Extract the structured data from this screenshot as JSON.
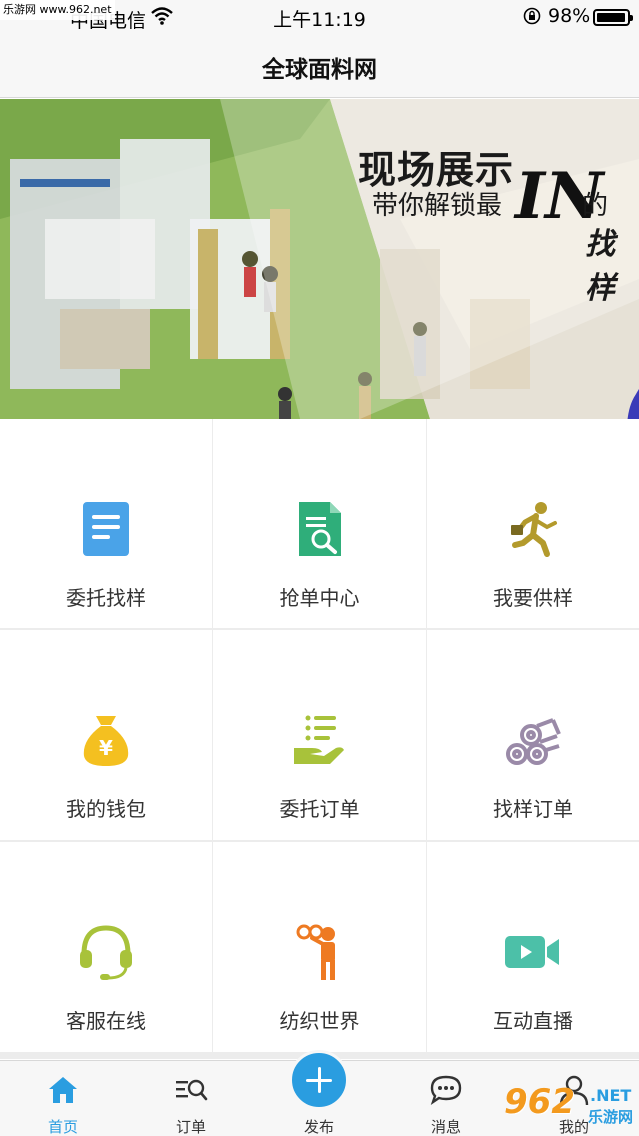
{
  "status_bar": {
    "watermark": "乐游网 www.962.net",
    "carrier": "中国电信",
    "time": "上午11:19",
    "battery": "98%"
  },
  "nav": {
    "title": "全球面料网"
  },
  "banner": {
    "headline": "现场展示",
    "subline": "带你解锁最",
    "big_text": "IN",
    "suffix": "的",
    "corner_text": "找样",
    "slide_count": 3,
    "active_slide": 1
  },
  "grid": {
    "items": [
      {
        "label": "委托找样",
        "icon": "document-icon",
        "color": "#4aa3e8"
      },
      {
        "label": "抢单中心",
        "icon": "document-search-icon",
        "color": "#2fae7a"
      },
      {
        "label": "我要供样",
        "icon": "running-man-icon",
        "color": "#b39a2c"
      },
      {
        "label": "我的钱包",
        "icon": "money-bag-icon",
        "color": "#f4c020"
      },
      {
        "label": "委托订单",
        "icon": "hand-list-icon",
        "color": "#a8c23a"
      },
      {
        "label": "找样订单",
        "icon": "fabric-rolls-icon",
        "color": "#9a8aa8"
      },
      {
        "label": "客服在线",
        "icon": "headset-icon",
        "color": "#a8c23a"
      },
      {
        "label": "纺织世界",
        "icon": "binoculars-man-icon",
        "color": "#ee7a22"
      },
      {
        "label": "互动直播",
        "icon": "video-camera-icon",
        "color": "#4cc0a8"
      }
    ]
  },
  "tab_bar": {
    "tabs": [
      {
        "label": "首页",
        "icon": "home-icon"
      },
      {
        "label": "订单",
        "icon": "order-search-icon"
      },
      {
        "label": "发布",
        "icon": "plus-icon"
      },
      {
        "label": "消息",
        "icon": "message-icon"
      },
      {
        "label": "我的",
        "icon": "person-icon"
      }
    ],
    "active_color": "#2a9de0"
  },
  "watermark_br": {
    "number": "962",
    "net": ".NET",
    "cn": "乐游网"
  }
}
